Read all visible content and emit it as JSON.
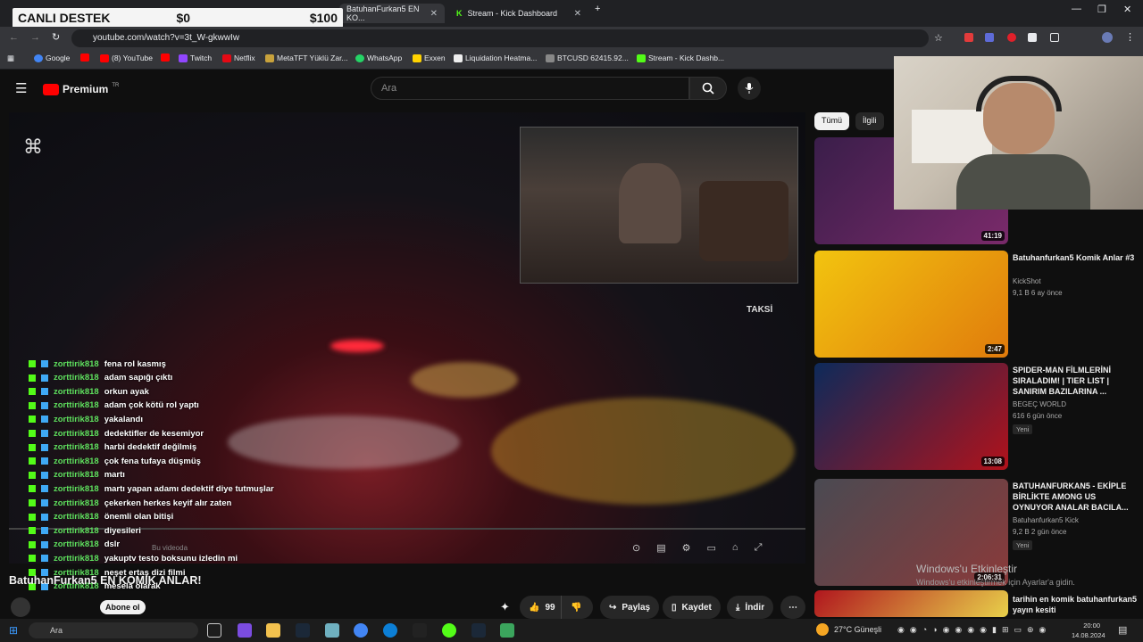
{
  "browser": {
    "tabs": [
      {
        "label": "BatuhanFurkan5 EN KO..."
      },
      {
        "label": "Stream - Kick Dashboard"
      }
    ],
    "url": "youtube.com/watch?v=3t_W-gkwwIw",
    "bookmarks": [
      "Google",
      "(8) YouTube",
      "Twitch",
      "Netflix",
      "MetaTFT Yüklü Zar...",
      "WhatsApp",
      "Exxen",
      "Liquidation Heatma...",
      "BTCUSD 62415.92...",
      "Stream - Kick Dashb..."
    ]
  },
  "overlay": {
    "label": "CANLI DESTEK",
    "amount_left": "$0",
    "amount_right": "$100"
  },
  "youtube": {
    "brand": "Premium",
    "brand_sup": "TR",
    "search_placeholder": "Ara",
    "chips": [
      "Tümü",
      "İlgili"
    ],
    "video_title": "BatuhanFurkan5 EN KOMİK ANLAR!",
    "video_overlay_text": "TAKSİ",
    "more_videos_label": "Bu videoda",
    "subscribe_label": "Abone ol",
    "likes": "99",
    "share_label": "Paylaş",
    "save_label": "Kaydet",
    "download_label": "İndir"
  },
  "chat": [
    {
      "user": "zorttirik818",
      "msg": "fena rol kasmış"
    },
    {
      "user": "zorttirik818",
      "msg": "adam sapığı çıktı"
    },
    {
      "user": "zorttirik818",
      "msg": "orkun ayak"
    },
    {
      "user": "zorttirik818",
      "msg": "adam çok kötü rol yaptı"
    },
    {
      "user": "zorttirik818",
      "msg": "yakalandı"
    },
    {
      "user": "zorttirik818",
      "msg": "dedektifler de kesemiyor"
    },
    {
      "user": "zorttirik818",
      "msg": "harbi dedektif değilmiş"
    },
    {
      "user": "zorttirik818",
      "msg": "çok fena tufaya düşmüş"
    },
    {
      "user": "zorttirik818",
      "msg": "martı"
    },
    {
      "user": "zorttirik818",
      "msg": "martı yapan adamı dedektif diye tutmuşlar"
    },
    {
      "user": "zorttirik818",
      "msg": "çekerken herkes keyif alır zaten"
    },
    {
      "user": "zorttirik818",
      "msg": "önemli olan bitişi"
    },
    {
      "user": "zorttirik818",
      "msg": "diyesileri"
    },
    {
      "user": "zorttirik818",
      "msg": "dslr"
    },
    {
      "user": "zorttirik818",
      "msg": "yakuptv testo boksunu izledin mi"
    },
    {
      "user": "zorttirik818",
      "msg": "neşet ertaş dizi filmi"
    },
    {
      "user": "zorttirik818",
      "msg": "mesela olarak"
    }
  ],
  "recommendations": [
    {
      "duration": "41:19",
      "title": "",
      "channel": "",
      "meta": "",
      "tag": "",
      "colors": [
        "#3a1e4a",
        "#7a2a6a"
      ]
    },
    {
      "duration": "2:47",
      "title": "Batuhanfurkan5 Komik Anlar #3",
      "channel": "KickShot",
      "meta": "9,1 B  6 ay önce",
      "tag": "",
      "colors": [
        "#f2c40f",
        "#e07b0c"
      ]
    },
    {
      "duration": "13:08",
      "title": "SPIDER-MAN FİLMLERİNİ SIRALADIM! | TIER LIST | SANIRIM BAZILARINA ...",
      "channel": "BEGEÇ WORLD",
      "meta": "616  6 gün önce",
      "tag": "Yeni",
      "colors": [
        "#0d2a5a",
        "#b1121b"
      ]
    },
    {
      "duration": "2:06:31",
      "title": "BATUHANFURKAN5 - EKİPLE BİRLİKTE AMONG US OYNUYOR ANALAR BACILA...",
      "channel": "Batuhanfurkan5 Kick",
      "meta": "9,2 B  2 gün önce",
      "tag": "Yeni",
      "colors": [
        "#4a4a52",
        "#8a3a3a"
      ]
    },
    {
      "duration": "",
      "title": "tarihin en komik batuhanfurkan5 yayın kesiti",
      "channel": "",
      "meta": "",
      "tag": "",
      "colors": [
        "#b0161e",
        "#e8d04a"
      ]
    }
  ],
  "windows_watermark": {
    "line1": "Windows'u Etkinleştir",
    "line2": "Windows'u etkinleştirmek için Ayarlar'a gidin."
  },
  "taskbar": {
    "search": "Ara",
    "weather": "27°C  Güneşli",
    "time": "20:00",
    "date": "14.08.2024"
  }
}
